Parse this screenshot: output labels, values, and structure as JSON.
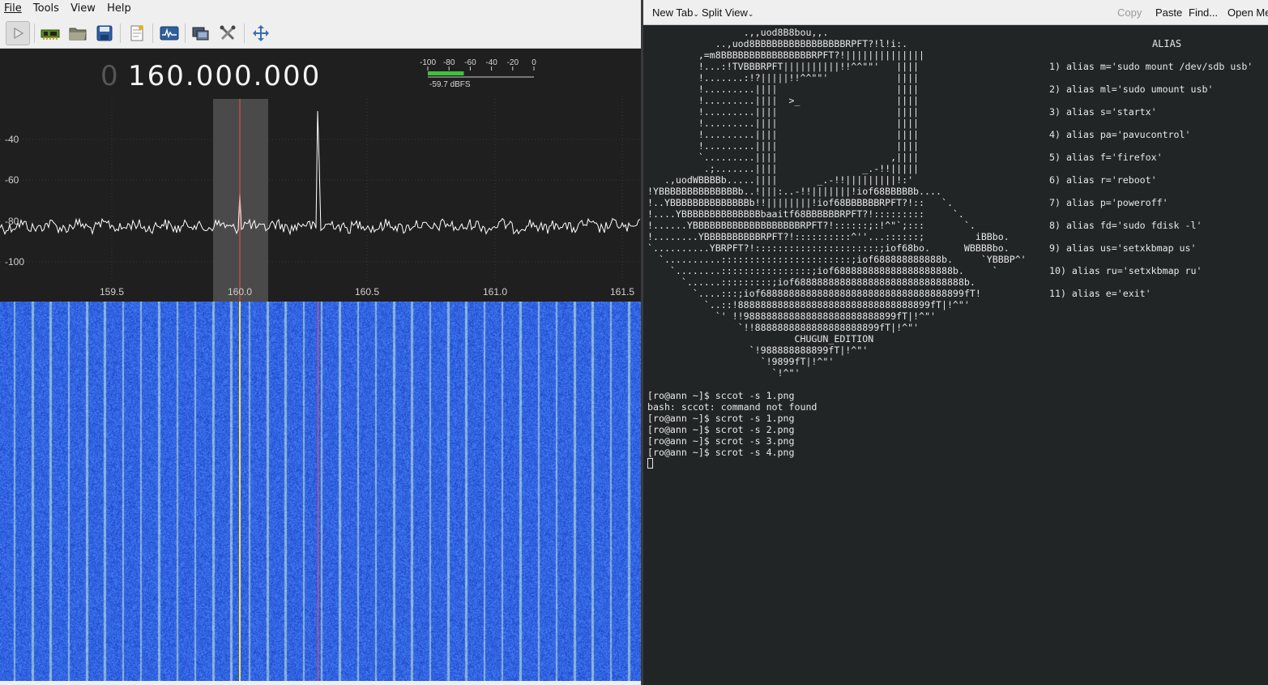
{
  "sdr": {
    "menu": [
      "File",
      "Tools",
      "View",
      "Help"
    ],
    "toolbar_icons": [
      "play-icon",
      "hardware-icon",
      "folder-open-icon",
      "save-icon",
      "bookmark-icon",
      "spectrum-icon",
      "network-icon",
      "tools-icon",
      "fullscreen-icon"
    ],
    "freq_lead": "0",
    "frequency": "160.000.000",
    "meter": {
      "ticks": [
        "-100",
        "-80",
        "-60",
        "-40",
        "-20",
        "0"
      ],
      "level_fraction": 0.34,
      "readout": "-59.7 dBFS",
      "bar_color": "#3cc43c"
    },
    "spectrum": {
      "y_ticks": [
        "-40",
        "-60",
        "-80",
        "-100"
      ],
      "x_ticks": [
        "159.5",
        "160.0",
        "160.5",
        "161.0",
        "161.5"
      ],
      "trace_color": "#ffffff",
      "filter_color": "#4a4a4a",
      "marker_color": "#ff4a4a"
    },
    "waterfall": {
      "base_color": "#2a57d9",
      "stripe_color": "#8fb3cf",
      "center_line_color": "#f2e84a",
      "marker_color": "#ff4a4a"
    }
  },
  "terminal": {
    "toolbar": {
      "new_tab": "New Tab",
      "split_view": "Split View",
      "copy": "Copy",
      "paste": "Paste",
      "find": "Find...",
      "open_menu": "Open Me"
    },
    "ascii_art": "                 .,,uod8B8bou,,.\n            ..,uod8BBBBBBBBBBBBBBBBRPFT?!l!i:.\n         ,=m8BBBBBBBBBBBBBBBBRPFT?!||||||||||||||\n         !...:!TVBBBRPFT||||||||||!!^^\"\"'   ||||\n         !.......:!?|||||!!^^\"\"'            ||||\n         !.........||||                     ||||\n         !.........||||  >_                 ||||\n         !.........||||                     ||||\n         !.........||||                     ||||\n         !.........||||                     ||||\n         !.........||||                     ||||\n         `.........||||                    ,||||\n          .;.......||||               _.-!!|||||\n   .,uodWBBBBb.....||||       _.-!!|||||||||!:'\n!YBBBBBBBBBBBBBBb..!|||:..-!!|||||||!iof68BBBBBb....\n!..YBBBBBBBBBBBBBBb!!||||||||!iof68BBBBBBRPFT?!::   `.\n!....YBBBBBBBBBBBBBBbaaitf68BBBBBBRPFT?!:::::::::     `.\n!......YBBBBBBBBBBBBBBBBBBBRPFT?!::::::;:!^\"`;:::       `.\n!........YBBBBBBBBBBRPFT?!::::::::::^''...::::::;         iBBbo.\n`..........YBRPFT?!::::::::::::::::::::::;iof68bo.      WBBBBbo.\n  `..........:::::::::::::::::::::::;iof688888888888b.     `YBBBP^'\n    `........::::::::::::::::;iof688888888888888888888b.     `\n      `......:::::::::;iof688888888888888888888888888888b.\n        `....:::;iof688888888888888888888888888888888899fT!\n          `..::!8888888888888888888888888888888899fT|!^\"'\n            `' !!988888888888888888888888899fT|!^\"'\n                `!!8888888888888888888899fT|!^\"'\n                          CHUGUN_EDITION\n                  `!988888888899fT|!^\"'\n                    `!9899fT|!^\"'\n                      `!^\"'",
    "alias_title": "ALIAS",
    "aliases": [
      "1) alias m='sudo mount /dev/sdb usb'",
      "2) alias ml='sudo umount usb'",
      "3) alias s='startx'",
      "4) alias pa='pavucontrol'",
      "5) alias f='firefox'",
      "6) alias r='reboot'",
      "7) alias p='poweroff'",
      "8) alias fd='sudo fdisk -l'",
      "9) alias us='setxkbmap us'",
      "10) alias ru='setxkbmap ru'",
      "11) alias e='exit'"
    ],
    "shell_lines": [
      "[ro@ann ~]$ sccot -s 1.png",
      "bash: sccot: command not found",
      "[ro@ann ~]$ scrot -s 1.png",
      "[ro@ann ~]$ scrot -s 2.png",
      "[ro@ann ~]$ scrot -s 3.png",
      "[ro@ann ~]$ scrot -s 4.png"
    ]
  }
}
